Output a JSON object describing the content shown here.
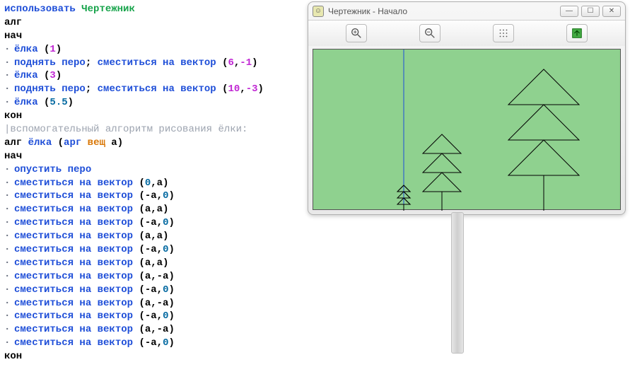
{
  "editor": {
    "use_kw": "использовать",
    "module": "Чертежник",
    "alg": "алг",
    "begin": "нач",
    "end": "кон",
    "call_fn": "ёлка",
    "penup": "поднять перо",
    "moveby": "сместиться на вектор",
    "pendown": "опустить перо",
    "arg_kw": "арг",
    "real_kw": "вещ",
    "param": "a",
    "comment": "|вспомогательный алгоритм рисования ёлки:",
    "calls": [
      {
        "arg": "1"
      },
      {
        "penup_then_move": true,
        "dx": "6",
        "dy": "-1"
      },
      {
        "arg": "3"
      },
      {
        "penup_then_move": true,
        "dx": "10",
        "dy": "-3"
      },
      {
        "arg": "5.5"
      }
    ],
    "body": [
      {
        "pendown": true
      },
      {
        "move": true,
        "x": "0",
        "y": "a"
      },
      {
        "move": true,
        "x": "-a",
        "y": "0"
      },
      {
        "move": true,
        "x": "a",
        "y": "a"
      },
      {
        "move": true,
        "x": "-a",
        "y": "0"
      },
      {
        "move": true,
        "x": "a",
        "y": "a"
      },
      {
        "move": true,
        "x": "-a",
        "y": "0"
      },
      {
        "move": true,
        "x": "a",
        "y": "a"
      },
      {
        "move": true,
        "x": "a",
        "y": "-a"
      },
      {
        "move": true,
        "x": "-a",
        "y": "0"
      },
      {
        "move": true,
        "x": "a",
        "y": "-a"
      },
      {
        "move": true,
        "x": "-a",
        "y": "0"
      },
      {
        "move": true,
        "x": "a",
        "y": "-a"
      },
      {
        "move": true,
        "x": "-a",
        "y": "0"
      }
    ]
  },
  "window": {
    "title": "Чертежник - Начало",
    "icon": "☺"
  },
  "colors": {
    "canvas": "#8fd18f",
    "pen": "#000000",
    "axis": "#1e4ed8"
  }
}
